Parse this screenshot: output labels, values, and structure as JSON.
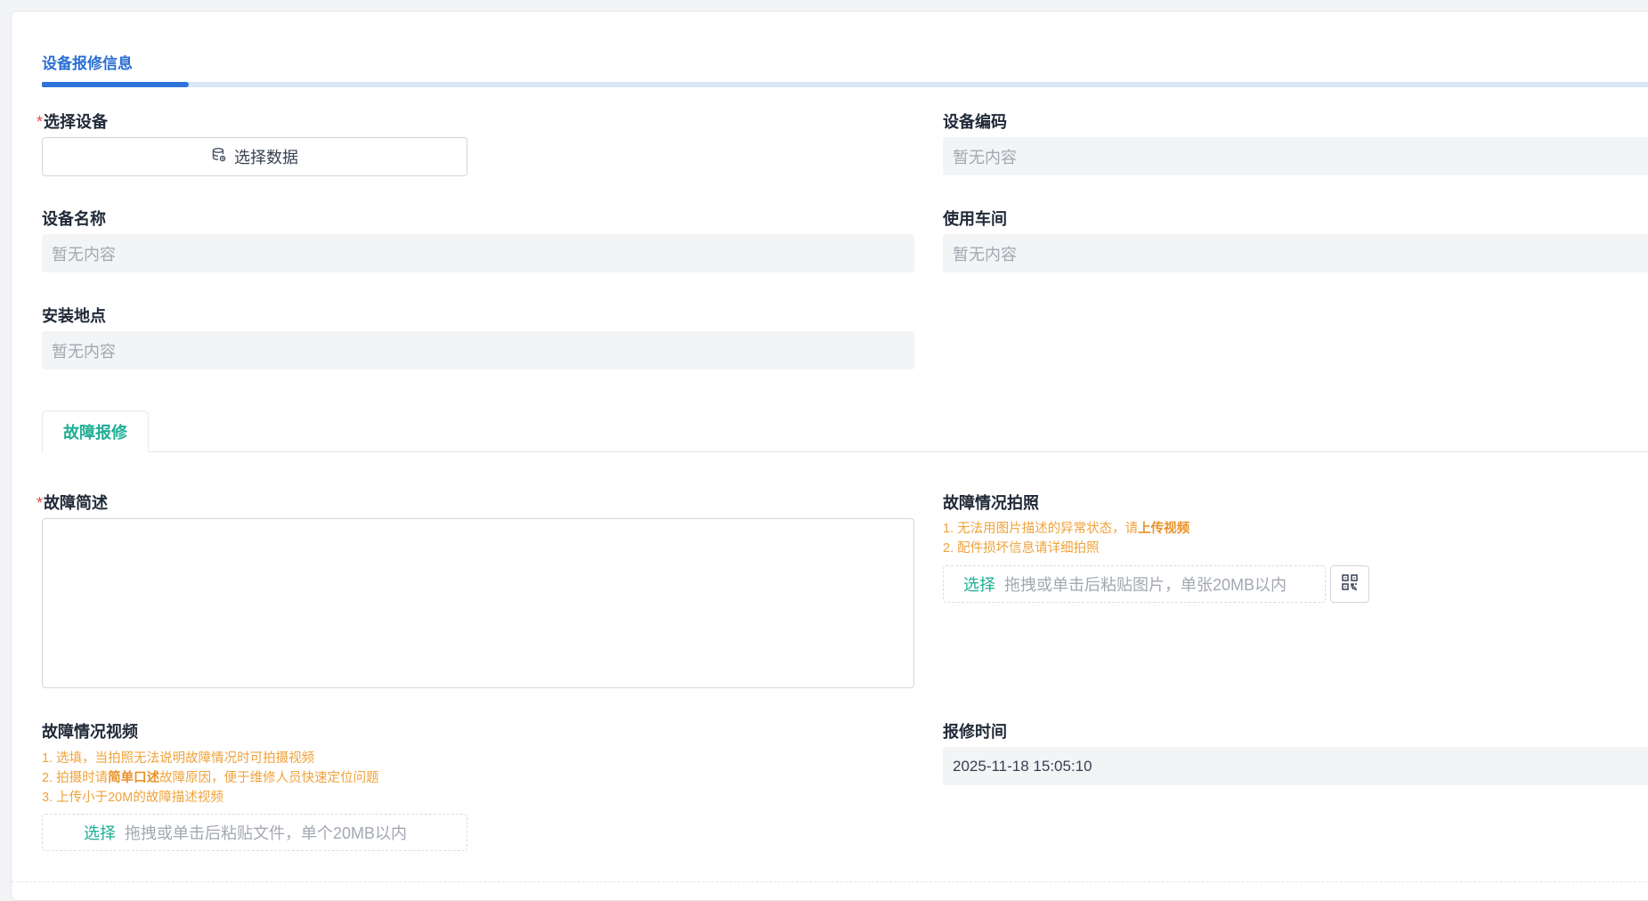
{
  "header": {
    "section_title": "设备报修信息",
    "progress": 0.09
  },
  "equipment": {
    "select_device_label": "选择设备",
    "select_data_button": "选择数据",
    "device_code_label": "设备编码",
    "device_code_value": "暂无内容",
    "device_name_label": "设备名称",
    "device_name_value": "暂无内容",
    "workshop_label": "使用车间",
    "workshop_value": "暂无内容",
    "location_label": "安装地点",
    "location_value": "暂无内容"
  },
  "tabs": [
    {
      "label": "故障报修",
      "active": true
    }
  ],
  "fault": {
    "description_label": "故障简述",
    "description_value": "",
    "photo_label": "故障情况拍照",
    "photo_hint_1_prefix": "1. 无法用图片描述的异常状态，请",
    "photo_hint_1_bold": "上传视频",
    "photo_hint_2": "2. 配件损坏信息请详细拍照",
    "photo_upload_pick": "选择",
    "photo_upload_placeholder": "拖拽或单击后粘贴图片，单张20MB以内",
    "video_label": "故障情况视频",
    "video_hint_1": "1. 选填，当拍照无法说明故障情况时可拍摄视频",
    "video_hint_2_prefix": "2. 拍摄时请",
    "video_hint_2_bold": "简单口述",
    "video_hint_2_suffix": "故障原因，便于维修人员快速定位问题",
    "video_hint_3": "3. 上传小于20M的故障描述视频",
    "video_upload_pick": "选择",
    "video_upload_placeholder": "拖拽或单击后粘贴文件，单个20MB以内",
    "repair_time_label": "报修时间",
    "repair_time_value": "2025-11-18 15:05:10"
  },
  "colors": {
    "primary_blue": "#2f74d8",
    "tab_green": "#1fae95",
    "hint_orange": "#f0a23a",
    "required_red": "#e5484d"
  },
  "icons": {
    "select_data": "database-icon",
    "qr": "qr-code-icon"
  }
}
